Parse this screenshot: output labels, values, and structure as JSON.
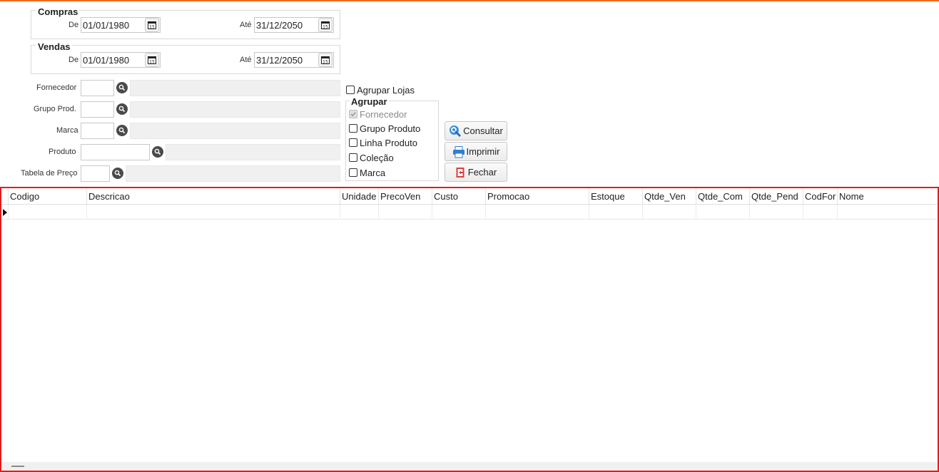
{
  "compras": {
    "title": "Compras",
    "de_label": "De",
    "de_value": "01/01/1980",
    "ate_label": "Até",
    "ate_value": "31/12/2050"
  },
  "vendas": {
    "title": "Vendas",
    "de_label": "De",
    "de_value": "01/01/1980",
    "ate_label": "Até",
    "ate_value": "31/12/2050"
  },
  "filters": {
    "fornecedor_label": "Fornecedor",
    "grupo_label": "Grupo Prod.",
    "marca_label": "Marca",
    "produto_label": "Produto",
    "tabela_label": "Tabela de Preço"
  },
  "agrupar_lojas": {
    "label": "Agrupar Lojas",
    "checked": false
  },
  "agrupar": {
    "title": "Agrupar",
    "items": [
      {
        "label": "Fornecedor",
        "checked": true,
        "disabled": true
      },
      {
        "label": "Grupo Produto",
        "checked": false,
        "disabled": false
      },
      {
        "label": "Linha Produto",
        "checked": false,
        "disabled": false
      },
      {
        "label": "Coleção",
        "checked": false,
        "disabled": false
      },
      {
        "label": "Marca",
        "checked": false,
        "disabled": false
      }
    ]
  },
  "buttons": {
    "consultar": "Consultar",
    "imprimir": "Imprimir",
    "fechar": "Fechar"
  },
  "grid": {
    "columns": [
      "Codigo",
      "Descricao",
      "Unidade",
      "PrecoVen",
      "Custo",
      "Promocao",
      "Estoque",
      "Qtde_Ven",
      "Qtde_Com",
      "Qtde_Pend",
      "CodFor",
      "Nome"
    ]
  },
  "colors": {
    "accent_top": "#f26a1b",
    "grid_border": "#e01d1d",
    "search_icon": "#3a8fd8",
    "print_icon": "#2f7fd1",
    "close_icon": "#e23b3b"
  }
}
